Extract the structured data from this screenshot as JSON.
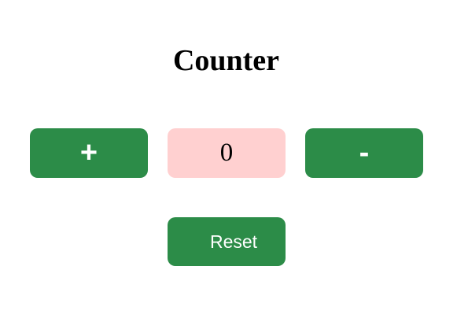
{
  "title": "Counter",
  "controls": {
    "increment_label": "+",
    "count_value": "0",
    "decrement_label": "-",
    "reset_label": "Reset"
  },
  "colors": {
    "button_background": "#2c8c48",
    "button_text": "#ffffff",
    "display_background": "#ffd0d0",
    "page_background": "#ffffff"
  }
}
